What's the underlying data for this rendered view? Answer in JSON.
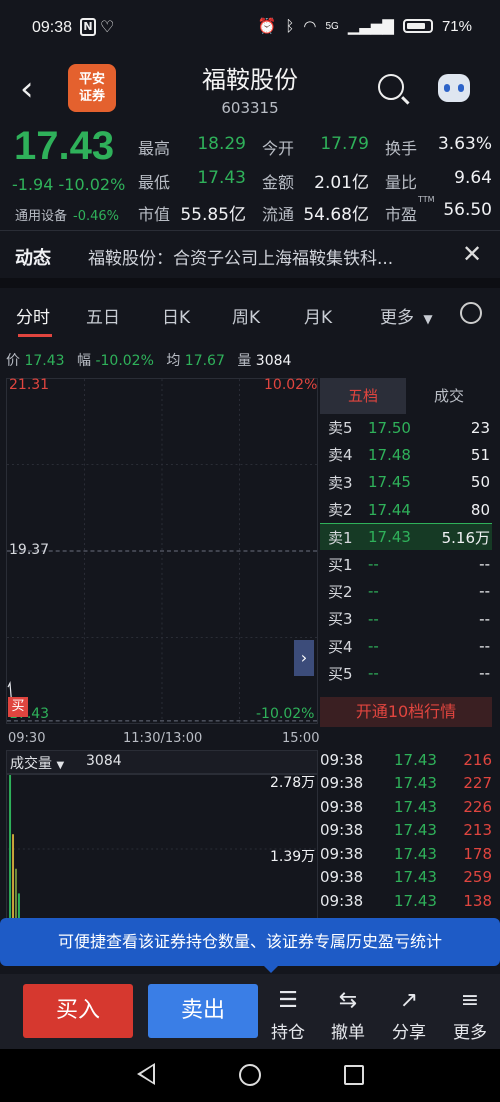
{
  "status_bar": {
    "time": "09:38",
    "n_icon": "N",
    "network": "5G",
    "battery": "71%"
  },
  "header": {
    "logo_line1": "平安",
    "logo_line2": "证券",
    "stock_name": "福鞍股份",
    "stock_code": "603315"
  },
  "quote": {
    "price": "17.43",
    "change": "-1.94",
    "change_pct": "-10.02%",
    "sector_name": "通用设备",
    "sector_change": "-0.46%",
    "fields": [
      {
        "label": "最高",
        "value": "18.29",
        "color": "#2fb15a"
      },
      {
        "label": "今开",
        "value": "17.79",
        "color": "#2fb15a"
      },
      {
        "label": "换手",
        "value": "3.63%",
        "color": "#f0f1f4"
      },
      {
        "label": "最低",
        "value": "17.43",
        "color": "#2fb15a"
      },
      {
        "label": "金额",
        "value": "2.01亿",
        "color": "#f0f1f4"
      },
      {
        "label": "量比",
        "value": "9.64",
        "color": "#f0f1f4"
      },
      {
        "label": "市值",
        "value": "55.85亿",
        "color": "#f0f1f4"
      },
      {
        "label": "流通",
        "value": "54.68亿",
        "color": "#f0f1f4"
      },
      {
        "label": "市盈",
        "value": "56.50",
        "color": "#f0f1f4",
        "sup": "TTM"
      }
    ]
  },
  "news": {
    "tag": "动态",
    "text": "福鞍股份：合资子公司上海福鞍集铁科..."
  },
  "tabs": [
    "分时",
    "五日",
    "日K",
    "周K",
    "月K",
    "更多"
  ],
  "chart_info": {
    "price_label": "价",
    "price": "17.43",
    "range_label": "幅",
    "range": "-10.02%",
    "avg_label": "均",
    "avg": "17.67",
    "vol_label": "量",
    "vol": "3084"
  },
  "chart_axes": {
    "y_top": "21.31",
    "y_mid": "19.37",
    "y_bottom": "17.43",
    "pct_top": "10.02%",
    "pct_bottom": "-10.02%",
    "buy_marker": "买",
    "time_start": "09:30",
    "time_mid": "11:30/13:00",
    "time_end": "15:00"
  },
  "order_book": {
    "tab_active": "五档",
    "tab_other": "成交",
    "rows": [
      {
        "label": "卖5",
        "price": "17.50",
        "vol": "23"
      },
      {
        "label": "卖4",
        "price": "17.48",
        "vol": "51"
      },
      {
        "label": "卖3",
        "price": "17.45",
        "vol": "50"
      },
      {
        "label": "卖2",
        "price": "17.44",
        "vol": "80"
      },
      {
        "label": "卖1",
        "price": "17.43",
        "vol": "5.16万"
      },
      {
        "label": "买1",
        "price": "--",
        "vol": "--"
      },
      {
        "label": "买2",
        "price": "--",
        "vol": "--"
      },
      {
        "label": "买3",
        "price": "--",
        "vol": "--"
      },
      {
        "label": "买4",
        "price": "--",
        "vol": "--"
      },
      {
        "label": "买5",
        "price": "--",
        "vol": "--"
      }
    ],
    "open_button": "开通10档行情"
  },
  "volume": {
    "label": "成交量",
    "value": "3084",
    "tick_high": "2.78万",
    "tick_mid": "1.39万"
  },
  "trades": [
    {
      "time": "09:38",
      "price": "17.43",
      "vol": "216"
    },
    {
      "time": "09:38",
      "price": "17.43",
      "vol": "227"
    },
    {
      "time": "09:38",
      "price": "17.43",
      "vol": "226"
    },
    {
      "time": "09:38",
      "price": "17.43",
      "vol": "213"
    },
    {
      "time": "09:38",
      "price": "17.43",
      "vol": "178"
    },
    {
      "time": "09:38",
      "price": "17.43",
      "vol": "259"
    },
    {
      "time": "09:38",
      "price": "17.43",
      "vol": "138"
    }
  ],
  "tooltip": "可便捷查看该证券持仓数量、该证券专属历史盈亏统计",
  "bottom_bar": {
    "buy": "买入",
    "sell": "卖出",
    "items": [
      {
        "label": "持仓",
        "icon": "holdings-icon"
      },
      {
        "label": "撤单",
        "icon": "cancel-order-icon"
      },
      {
        "label": "分享",
        "icon": "share-icon"
      },
      {
        "label": "更多",
        "icon": "more-menu-icon"
      }
    ]
  }
}
